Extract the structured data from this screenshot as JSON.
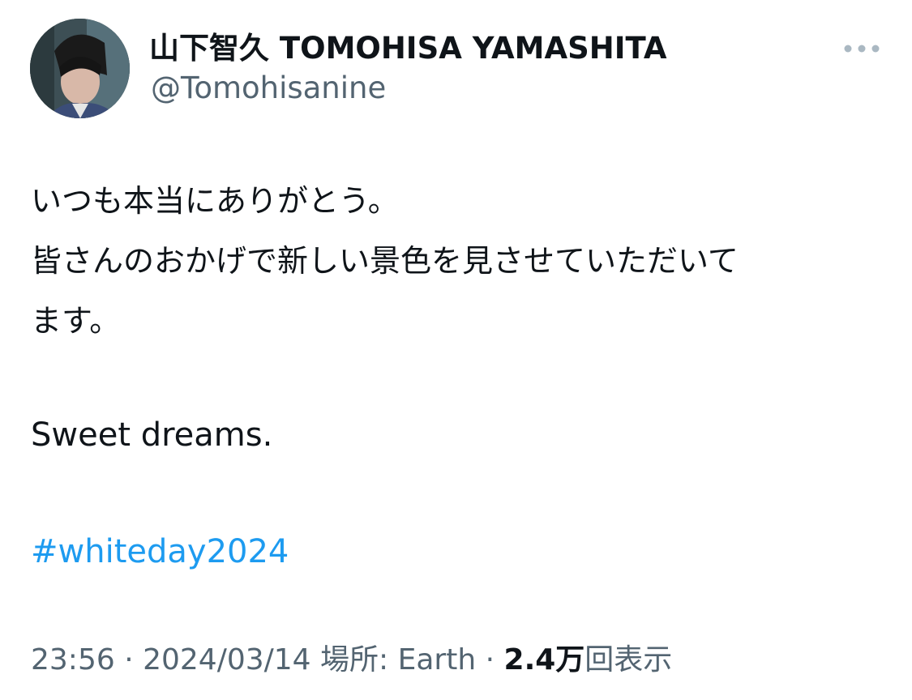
{
  "profile": {
    "display_name": "山下智久 TOMOHISA YAMASHITA",
    "handle": "@Tomohisanine"
  },
  "tweet": {
    "lines": [
      "いつも本当にありがとう。",
      "皆さんのおかげで新しい景色を見させていただいて",
      "ます。",
      "Sweet dreams."
    ],
    "hashtag": "#whiteday2024"
  },
  "meta": {
    "time": "23:56",
    "sep1": " · ",
    "date": "2024/03/14",
    "location_label": " 場所: ",
    "location": "Earth",
    "sep2": " · ",
    "views_count": "2.4万",
    "views_label": "回表示"
  },
  "colors": {
    "text": "#0f1419",
    "secondary": "#536471",
    "link": "#1d9bf0",
    "more_dots": "#aab8c2"
  },
  "icons": {
    "more": "more-horizontal-icon",
    "avatar": "profile-photo"
  }
}
